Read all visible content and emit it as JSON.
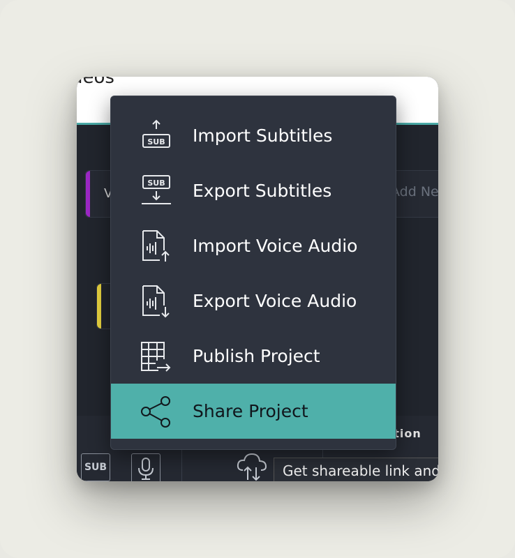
{
  "window": {
    "header_text": "deos",
    "track_letter": "V",
    "add_new_label": "Add Ne",
    "bottom_label": "nation",
    "sub_button_label": "SUB",
    "tooltip_text": "Get shareable link and"
  },
  "menu": {
    "items": [
      {
        "label": "Import Subtitles",
        "icon": "import-subtitles-icon"
      },
      {
        "label": "Export Subtitles",
        "icon": "export-subtitles-icon"
      },
      {
        "label": "Import Voice Audio",
        "icon": "import-voice-audio-icon"
      },
      {
        "label": "Export Voice Audio",
        "icon": "export-voice-audio-icon"
      },
      {
        "label": "Publish Project",
        "icon": "publish-project-icon"
      },
      {
        "label": "Share Project",
        "icon": "share-icon",
        "active": true
      }
    ],
    "icon_sub_text": "SUB"
  },
  "colors": {
    "accent_teal": "#4fb0aa",
    "menu_bg": "#2e333e",
    "window_bg": "#21252d",
    "purple_track": "#9b27c4",
    "yellow_track": "#e8d33f"
  }
}
